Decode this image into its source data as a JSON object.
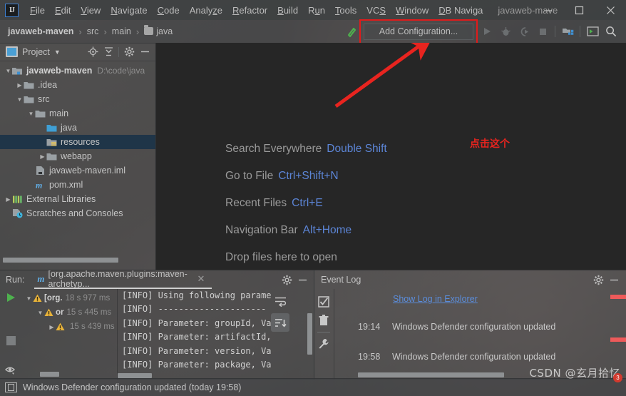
{
  "window": {
    "title": "javaweb-mave",
    "logo_text": "IJ",
    "minimize": "minimize-icon",
    "maximize": "maximize-icon",
    "close": "close-icon"
  },
  "menu": [
    {
      "label": "File",
      "mnemonic": "F"
    },
    {
      "label": "Edit",
      "mnemonic": "E"
    },
    {
      "label": "View",
      "mnemonic": "V"
    },
    {
      "label": "Navigate",
      "mnemonic": "N"
    },
    {
      "label": "Code",
      "mnemonic": "C"
    },
    {
      "label": "Analyze",
      "mnemonic": "z"
    },
    {
      "label": "Refactor",
      "mnemonic": "R"
    },
    {
      "label": "Build",
      "mnemonic": "B"
    },
    {
      "label": "Run",
      "mnemonic": "u"
    },
    {
      "label": "Tools",
      "mnemonic": "T"
    },
    {
      "label": "VCS",
      "mnemonic": "S"
    },
    {
      "label": "Window",
      "mnemonic": "W"
    },
    {
      "label": "DB Naviga",
      "mnemonic": "D"
    }
  ],
  "navbar": {
    "breadcrumbs": [
      "javaweb-maven",
      "src",
      "main",
      "java"
    ],
    "separator": "›",
    "add_configuration_label": "Add Configuration...",
    "icons": [
      "build-hammer-icon",
      "run-icon",
      "debug-icon",
      "run-with-coverage-icon",
      "stop-icon",
      "sync-project-icon",
      "select-run-config-icon",
      "search-everywhere-icon"
    ],
    "highlight_color": "#e01b1b"
  },
  "project_panel": {
    "title": "Project",
    "actions": [
      "locate-icon",
      "collapse-all-icon",
      "settings-gear-icon",
      "hide-icon"
    ],
    "tree": [
      {
        "label": "javaweb-maven",
        "path": "D:\\code\\java",
        "depth": 0,
        "arrow": "expanded",
        "icon": "module-icon",
        "bold": true,
        "selected": false
      },
      {
        "label": ".idea",
        "path": "",
        "depth": 1,
        "arrow": "collapsed",
        "icon": "folder-icon",
        "bold": false,
        "selected": false
      },
      {
        "label": "src",
        "path": "",
        "depth": 1,
        "arrow": "expanded",
        "icon": "folder-icon",
        "bold": false,
        "selected": false
      },
      {
        "label": "main",
        "path": "",
        "depth": 2,
        "arrow": "expanded",
        "icon": "folder-icon",
        "bold": false,
        "selected": false
      },
      {
        "label": "java",
        "path": "",
        "depth": 3,
        "arrow": "none",
        "icon": "sources-folder-icon",
        "bold": false,
        "selected": false
      },
      {
        "label": "resources",
        "path": "",
        "depth": 3,
        "arrow": "none",
        "icon": "resources-folder-icon",
        "bold": false,
        "selected": true
      },
      {
        "label": "webapp",
        "path": "",
        "depth": 3,
        "arrow": "collapsed",
        "icon": "folder-icon",
        "bold": false,
        "selected": false
      },
      {
        "label": "javaweb-maven.iml",
        "path": "",
        "depth": 2,
        "arrow": "none",
        "icon": "iml-file-icon",
        "bold": false,
        "selected": false
      },
      {
        "label": "pom.xml",
        "path": "",
        "depth": 2,
        "arrow": "none",
        "icon": "maven-pom-icon",
        "bold": false,
        "selected": false
      },
      {
        "label": "External Libraries",
        "path": "",
        "depth": 0,
        "arrow": "collapsed",
        "icon": "libraries-icon",
        "bold": false,
        "selected": false
      },
      {
        "label": "Scratches and Consoles",
        "path": "",
        "depth": 0,
        "arrow": "none",
        "icon": "scratches-icon",
        "bold": false,
        "selected": false
      }
    ]
  },
  "editor": {
    "hints": [
      {
        "action": "Search Everywhere",
        "shortcut": "Double Shift"
      },
      {
        "action": "Go to File",
        "shortcut": "Ctrl+Shift+N"
      },
      {
        "action": "Recent Files",
        "shortcut": "Ctrl+E"
      },
      {
        "action": "Navigation Bar",
        "shortcut": "Alt+Home"
      },
      {
        "action": "Drop files here to open",
        "shortcut": ""
      }
    ],
    "annotation_text": "点击这个",
    "annotation_color": "#e8241f",
    "background_color": "#262626",
    "shortcut_color": "#5c85d6"
  },
  "run_panel": {
    "label": "Run:",
    "tab_title": "[org.apache.maven.plugins:maven-archetyp...",
    "tab_close": "close-tab-icon",
    "actions": [
      "settings-gear-icon",
      "hide-icon"
    ],
    "gutter_buttons": [
      "rerun-icon",
      "stop-icon",
      "toggle-soft-wrap-icon",
      "expand-icon"
    ],
    "side_buttons": [
      "wrap-text-icon",
      "sort-icon"
    ],
    "tree": [
      {
        "label": "[org.",
        "time": "18 s 977 ms",
        "depth": 0,
        "arrow": "expanded"
      },
      {
        "label": "or",
        "time": "15 s 445 ms",
        "depth": 1,
        "arrow": "expanded"
      },
      {
        "label": "",
        "time": "15 s 439 ms",
        "depth": 2,
        "arrow": "collapsed"
      }
    ],
    "console_lines": [
      "[INFO] Using following parame",
      "[INFO] ---------------------",
      "[INFO] Parameter: groupId, Va",
      "[INFO] Parameter: artifactId,",
      "[INFO] Parameter: version, Va",
      "[INFO] Parameter: package, Va"
    ]
  },
  "event_log": {
    "title": "Event Log",
    "actions": [
      "settings-gear-icon",
      "hide-icon"
    ],
    "gutter_buttons": [
      "mark-all-read-icon",
      "delete-icon",
      "settings-wrench-icon"
    ],
    "link_label": "Show Log in Explorer",
    "entries": [
      {
        "time": "19:14",
        "message": "Windows Defender configuration updated"
      },
      {
        "time": "19:58",
        "message": "Windows Defender configuration updated"
      }
    ]
  },
  "statusbar": {
    "icon": "layout-icon",
    "message": "Windows Defender configuration updated (today 19:58)"
  },
  "watermark": {
    "text": "CSDN @玄月拾忆",
    "badge": "3"
  }
}
